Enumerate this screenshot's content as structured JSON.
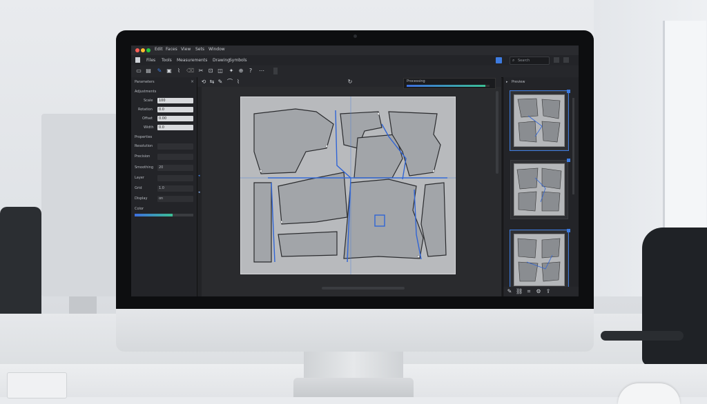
{
  "window": {
    "menu": [
      "Edit",
      "Faces",
      "View",
      "Sets",
      "Window"
    ]
  },
  "menubar": {
    "items": [
      "Files",
      "Tools",
      "Measurements",
      "Drawing",
      "Symbols"
    ]
  },
  "search": {
    "placeholder": "Search"
  },
  "left_panel": {
    "title": "Parameters",
    "section_1": "Adjustments",
    "fields": [
      {
        "label": "Scale",
        "value": "100"
      },
      {
        "label": "Rotation",
        "value": "0.0"
      },
      {
        "label": "Offset",
        "value": "0.00"
      },
      {
        "label": "Width",
        "value": "0.0"
      }
    ],
    "section_2": "Properties",
    "rows": [
      {
        "label": "Resolution",
        "value": ""
      },
      {
        "label": "Precision",
        "value": ""
      },
      {
        "label": "Smoothing",
        "value": "20"
      },
      {
        "label": "Layer",
        "value": ""
      },
      {
        "label": "Grid",
        "value": "1.0"
      },
      {
        "label": "Display",
        "value": "on"
      }
    ],
    "color_label": "Color",
    "progress": 0.65
  },
  "canvas": {
    "progress_label": "Processing",
    "progress": 0.95
  },
  "right_panel": {
    "title": "Preview",
    "thumbnails": 3
  },
  "colors": {
    "accent": "#3d7be0",
    "progress_end": "#3bbf94",
    "piece": "#9fa2a6",
    "cut": "#2f64d6"
  },
  "icons": [
    "new-file-icon",
    "open-icon",
    "pen-icon",
    "select-icon",
    "brush-icon",
    "eraser-icon",
    "crop-icon",
    "lock-icon",
    "zoom-icon",
    "help-icon",
    "rotate-icon"
  ]
}
